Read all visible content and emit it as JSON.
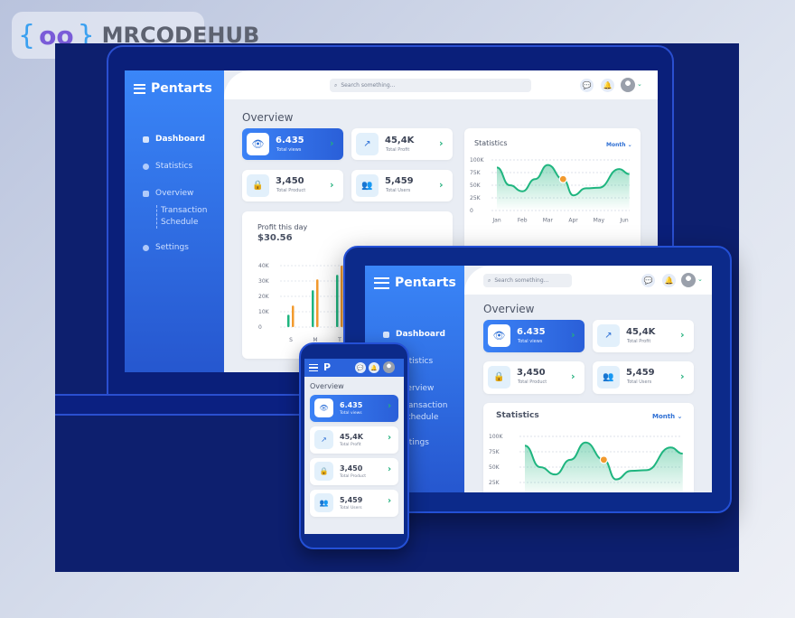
{
  "watermark": {
    "brace_open": "{",
    "oo": "oo",
    "brace_close": "}",
    "text": "MRCODEHUB"
  },
  "app": {
    "name": "Pentarts",
    "short_name": "P",
    "search_placeholder": "Search something...",
    "overview": "Overview"
  },
  "nav": [
    {
      "label": "Dashboard",
      "icon": "grid-icon",
      "active": true
    },
    {
      "label": "Statistics",
      "icon": "pie-chart-icon"
    },
    {
      "label": "Overview",
      "icon": "chart-icon"
    },
    {
      "label": "Settings",
      "icon": "gear-icon"
    }
  ],
  "nav_sub": [
    "Transaction",
    "Schedule"
  ],
  "stats": [
    {
      "value": "6.435",
      "label": "Total views",
      "icon": "eye-icon"
    },
    {
      "value": "45,4K",
      "label": "Total Profit",
      "icon": "trend-up-icon"
    },
    {
      "value": "3,450",
      "label": "Total Product",
      "icon": "lock-icon"
    },
    {
      "value": "5,459",
      "label": "Total Users",
      "icon": "users-icon"
    }
  ],
  "statistics": {
    "title": "Statistics",
    "period": "Month"
  },
  "profit": {
    "title": "Profit this day",
    "amount": "$30.56"
  },
  "colors": {
    "accent": "#3b82f6",
    "green": "#1fb57f",
    "orange": "#f29a2e",
    "navy": "#0d1f6e"
  },
  "chart_data": [
    {
      "type": "area",
      "title": "Statistics",
      "categories": [
        "Jan",
        "Feb",
        "Mar",
        "Apr",
        "May",
        "Jun"
      ],
      "yticks": [
        "100K",
        "75K",
        "50K",
        "25K",
        "0"
      ],
      "ylim": [
        0,
        100000
      ],
      "x": [
        0,
        0.5,
        1,
        1.5,
        2,
        2.6,
        3,
        3.5,
        4,
        4.8,
        5.2
      ],
      "y": [
        85000,
        50000,
        38000,
        62000,
        90000,
        62000,
        30000,
        44000,
        45000,
        82000,
        72000
      ],
      "highlight": {
        "x": 2.6,
        "y": 62000
      },
      "grid": true
    },
    {
      "type": "bar",
      "categories": [
        "S",
        "M",
        "T"
      ],
      "yticks": [
        "40K",
        "30K",
        "20K",
        "10K",
        "0"
      ],
      "ylim": [
        0,
        40000
      ],
      "series": [
        {
          "values": [
            8000,
            24000,
            34000
          ]
        },
        {
          "values": [
            14000,
            31000,
            40000
          ]
        }
      ],
      "grid": true
    }
  ]
}
